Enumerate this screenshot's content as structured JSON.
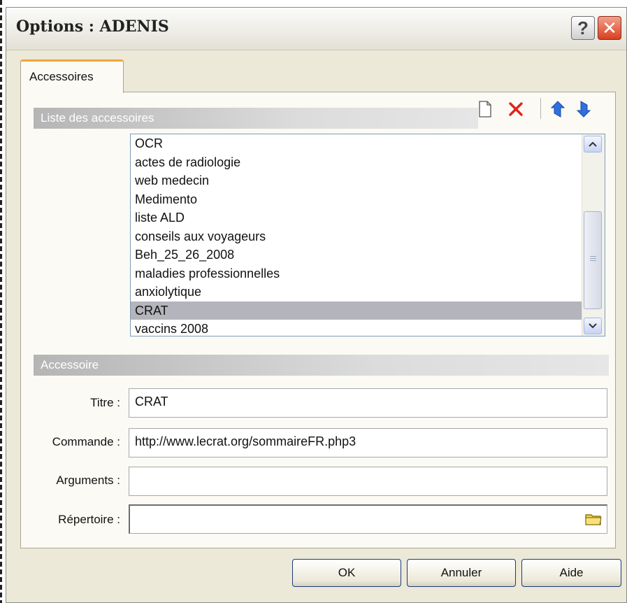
{
  "window": {
    "title": "Options : ADENIS",
    "help_glyph": "?",
    "close_glyph": "✕"
  },
  "tab": {
    "label": "Accessoires"
  },
  "list_section": {
    "header": "Liste des accessoires",
    "toolbar": [
      "new-document-icon",
      "delete-x-icon",
      "move-up-arrow-icon",
      "move-down-arrow-icon"
    ],
    "items": [
      "OCR",
      "actes de radiologie",
      "web medecin",
      "Medimento",
      "liste ALD",
      "conseils aux voyageurs",
      "Beh_25_26_2008",
      "maladies professionnelles",
      "anxiolytique",
      "CRAT",
      "vaccins 2008"
    ],
    "selected": "CRAT"
  },
  "detail_section": {
    "header": "Accessoire",
    "titre_label": "Titre :",
    "titre_value": "CRAT",
    "commande_label": "Commande :",
    "commande_value": "http://www.lecrat.org/sommaireFR.php3",
    "arguments_label": "Arguments :",
    "arguments_value": "",
    "repertoire_label": "Répertoire :",
    "repertoire_value": ""
  },
  "buttons": {
    "ok": "OK",
    "cancel": "Annuler",
    "help": "Aide"
  },
  "colors": {
    "selection": "#b4b4bc",
    "dialog_bg": "#ece9d8",
    "tab_accent": "#f2a53a",
    "delete": "#e0221b",
    "arrows": "#2f6fe0"
  }
}
